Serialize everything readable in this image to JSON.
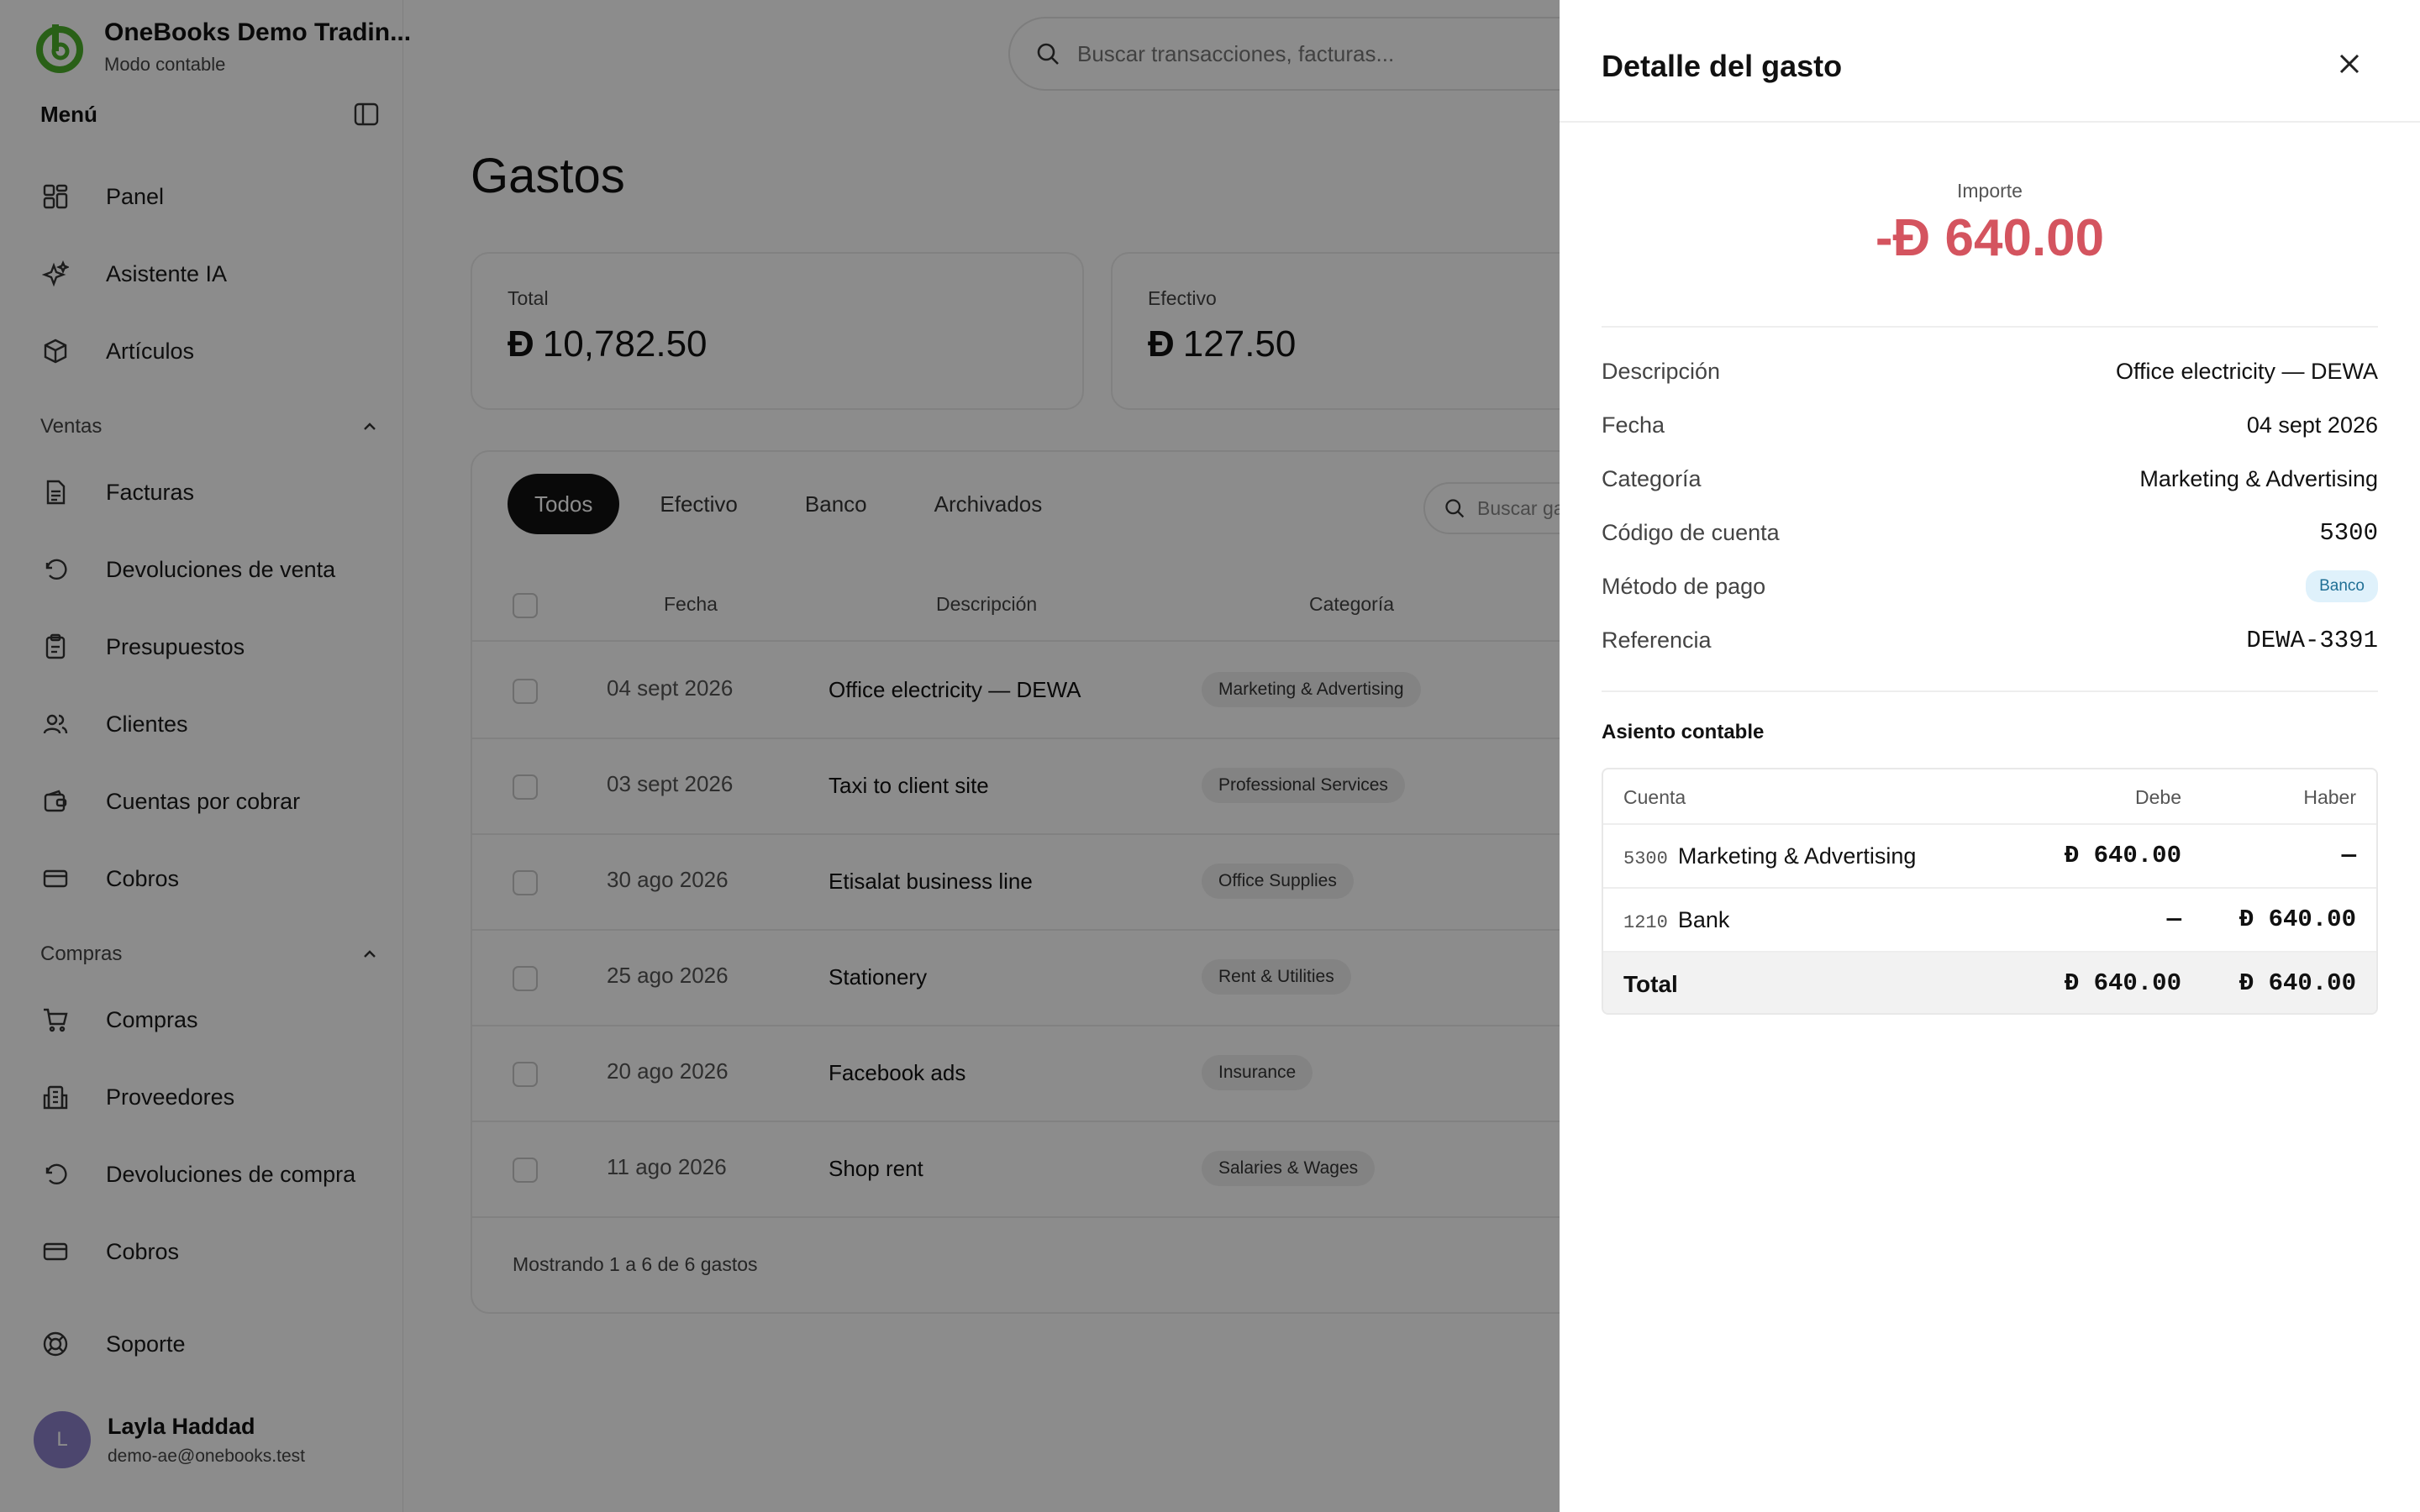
{
  "brand": {
    "name": "OneBooks Demo Tradin...",
    "mode": "Modo contable"
  },
  "sidebar": {
    "menu_title": "Menú",
    "top_items": [
      {
        "label": "Panel",
        "icon": "dashboard-icon"
      },
      {
        "label": "Asistente IA",
        "icon": "sparkles-icon"
      },
      {
        "label": "Artículos",
        "icon": "box-icon"
      }
    ],
    "sales": {
      "title": "Ventas",
      "items": [
        {
          "label": "Facturas",
          "icon": "document-icon"
        },
        {
          "label": "Devoluciones de venta",
          "icon": "undo-icon"
        },
        {
          "label": "Presupuestos",
          "icon": "clipboard-icon"
        },
        {
          "label": "Clientes",
          "icon": "users-icon"
        },
        {
          "label": "Cuentas por cobrar",
          "icon": "wallet-icon"
        },
        {
          "label": "Cobros",
          "icon": "card-icon"
        }
      ]
    },
    "purchases": {
      "title": "Compras",
      "items": [
        {
          "label": "Compras",
          "icon": "cart-icon"
        },
        {
          "label": "Proveedores",
          "icon": "building-icon"
        },
        {
          "label": "Devoluciones de compra",
          "icon": "undo-icon"
        },
        {
          "label": "Cobros",
          "icon": "card-icon"
        }
      ]
    },
    "support": "Soporte",
    "user": {
      "initial": "L",
      "name": "Layla Haddad",
      "email": "demo-ae@onebooks.test"
    }
  },
  "search": {
    "placeholder": "Buscar transacciones, facturas..."
  },
  "page": {
    "title": "Gastos",
    "cards": [
      {
        "label": "Total",
        "currency": "Đ",
        "value": "10,782.50"
      },
      {
        "label": "Efectivo",
        "currency": "Đ",
        "value": "127.50"
      }
    ],
    "tabs": [
      "Todos",
      "Efectivo",
      "Banco",
      "Archivados"
    ],
    "table_search_placeholder": "Buscar ga",
    "columns": {
      "date": "Fecha",
      "description": "Descripción",
      "category": "Categoría"
    },
    "rows": [
      {
        "date": "04 sept 2026",
        "description": "Office electricity — DEWA",
        "category": "Marketing & Advertising"
      },
      {
        "date": "03 sept 2026",
        "description": "Taxi to client site",
        "category": "Professional Services"
      },
      {
        "date": "30 ago 2026",
        "description": "Etisalat business line",
        "category": "Office Supplies"
      },
      {
        "date": "25 ago 2026",
        "description": "Stationery",
        "category": "Rent & Utilities"
      },
      {
        "date": "20 ago 2026",
        "description": "Facebook ads",
        "category": "Insurance"
      },
      {
        "date": "11 ago 2026",
        "description": "Shop rent",
        "category": "Salaries & Wages"
      }
    ],
    "footer": "Mostrando 1 a 6 de 6 gastos"
  },
  "drawer": {
    "title": "Detalle del gasto",
    "amount_label": "Importe",
    "amount": "-Đ 640.00",
    "fields": [
      {
        "key": "Descripción",
        "value": "Office electricity — DEWA"
      },
      {
        "key": "Fecha",
        "value": "04 sept 2026"
      },
      {
        "key": "Categoría",
        "value": "Marketing & Advertising"
      },
      {
        "key": "Código de cuenta",
        "value": "5300"
      },
      {
        "key": "Método de pago",
        "value": "Banco"
      },
      {
        "key": "Referencia",
        "value": "DEWA-3391"
      }
    ],
    "journal": {
      "title": "Asiento contable",
      "headers": {
        "account": "Cuenta",
        "debit": "Debe",
        "credit": "Haber"
      },
      "rows": [
        {
          "code": "5300",
          "account": "Marketing & Advertising",
          "debit": "Đ 640.00",
          "credit": "—"
        },
        {
          "code": "1210",
          "account": "Bank",
          "debit": "—",
          "credit": "Đ 640.00"
        }
      ],
      "total": {
        "label": "Total",
        "debit": "Đ 640.00",
        "credit": "Đ 640.00"
      }
    }
  },
  "colors": {
    "overlay": "#000000",
    "negative_amount": "#d4545f",
    "brand_green": "#4caf2a",
    "badge_bg": "#dff1fb"
  }
}
